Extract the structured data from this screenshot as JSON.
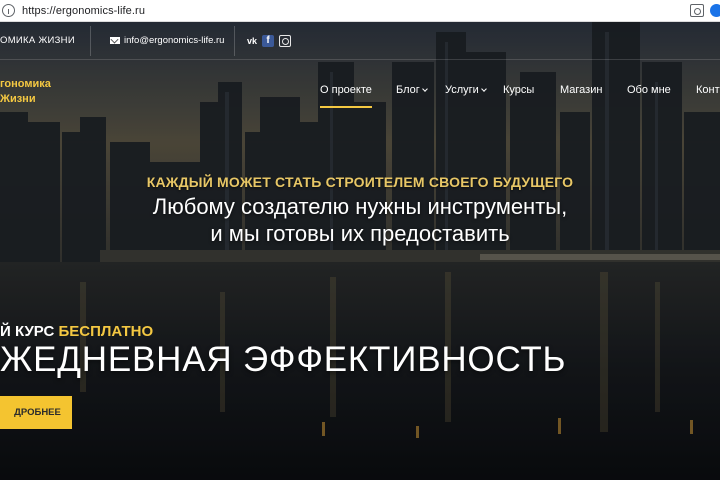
{
  "browser": {
    "url": "https://ergonomics-life.ru"
  },
  "topbar": {
    "brand": "ОМИКА ЖИЗНИ",
    "email": "info@ergonomics-life.ru",
    "social": [
      "vk",
      "f"
    ]
  },
  "logo": {
    "line1": "гономика",
    "line2": "Жизни"
  },
  "nav": {
    "items": [
      "О проекте",
      "Блог",
      "Услуги",
      "Курсы",
      "Магазин",
      "Обо мне",
      "Конт"
    ]
  },
  "hero": {
    "tagline": "КАЖДЫЙ МОЖЕТ СТАТЬ СТРОИТЕЛЕМ СВОЕГО БУДУЩЕГО",
    "headline1": "Любому создателю нужны инструменты,",
    "headline2": "и мы готовы их предоставить"
  },
  "promo": {
    "course_prefix": "Й КУРС",
    "course_accent": "БЕСПЛАТНО",
    "title": "ЖЕДНЕВНАЯ ЭФФЕКТИВНОСТЬ",
    "button": "ДРОБНЕЕ"
  },
  "colors": {
    "accent": "#f4c842",
    "button": "#f4c430"
  }
}
